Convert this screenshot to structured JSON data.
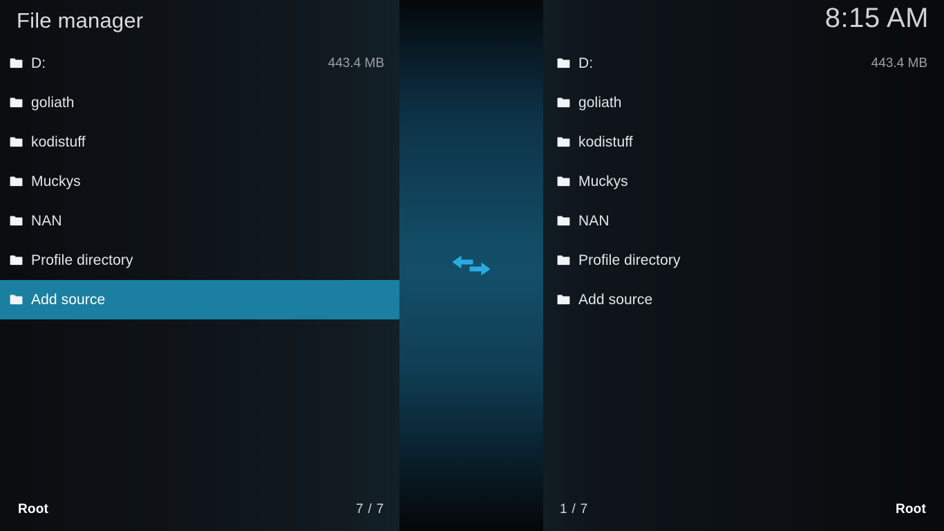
{
  "header": {
    "title": "File manager",
    "clock": "8:15 AM"
  },
  "theme": {
    "highlight_color": "#1a7fa0",
    "divider_accent_color": "#29abe2",
    "panel_background": "#0c1014",
    "label_color": "#e4e7e9",
    "size_color": "#9aa1a6"
  },
  "divider": {
    "icon": "swap-horizontal-arrows-icon"
  },
  "left_panel": {
    "items": [
      {
        "icon": "folder-icon",
        "label": "D:",
        "size": "443.4 MB",
        "selected": false
      },
      {
        "icon": "folder-icon",
        "label": "goliath",
        "size": "",
        "selected": false
      },
      {
        "icon": "folder-icon",
        "label": "kodistuff",
        "size": "",
        "selected": false
      },
      {
        "icon": "folder-icon",
        "label": "Muckys",
        "size": "",
        "selected": false
      },
      {
        "icon": "folder-icon",
        "label": "NAN",
        "size": "",
        "selected": false
      },
      {
        "icon": "folder-icon",
        "label": "Profile directory",
        "size": "",
        "selected": false
      },
      {
        "icon": "folder-icon",
        "label": "Add source",
        "size": "",
        "selected": true
      }
    ],
    "footer": {
      "path": "Root",
      "count": "7 / 7"
    }
  },
  "right_panel": {
    "items": [
      {
        "icon": "folder-icon",
        "label": "D:",
        "size": "443.4 MB",
        "selected": false
      },
      {
        "icon": "folder-icon",
        "label": "goliath",
        "size": "",
        "selected": false
      },
      {
        "icon": "folder-icon",
        "label": "kodistuff",
        "size": "",
        "selected": false
      },
      {
        "icon": "folder-icon",
        "label": "Muckys",
        "size": "",
        "selected": false
      },
      {
        "icon": "folder-icon",
        "label": "NAN",
        "size": "",
        "selected": false
      },
      {
        "icon": "folder-icon",
        "label": "Profile directory",
        "size": "",
        "selected": false
      },
      {
        "icon": "folder-icon",
        "label": "Add source",
        "size": "",
        "selected": false
      }
    ],
    "footer": {
      "path": "Root",
      "count": "1 / 7"
    }
  }
}
